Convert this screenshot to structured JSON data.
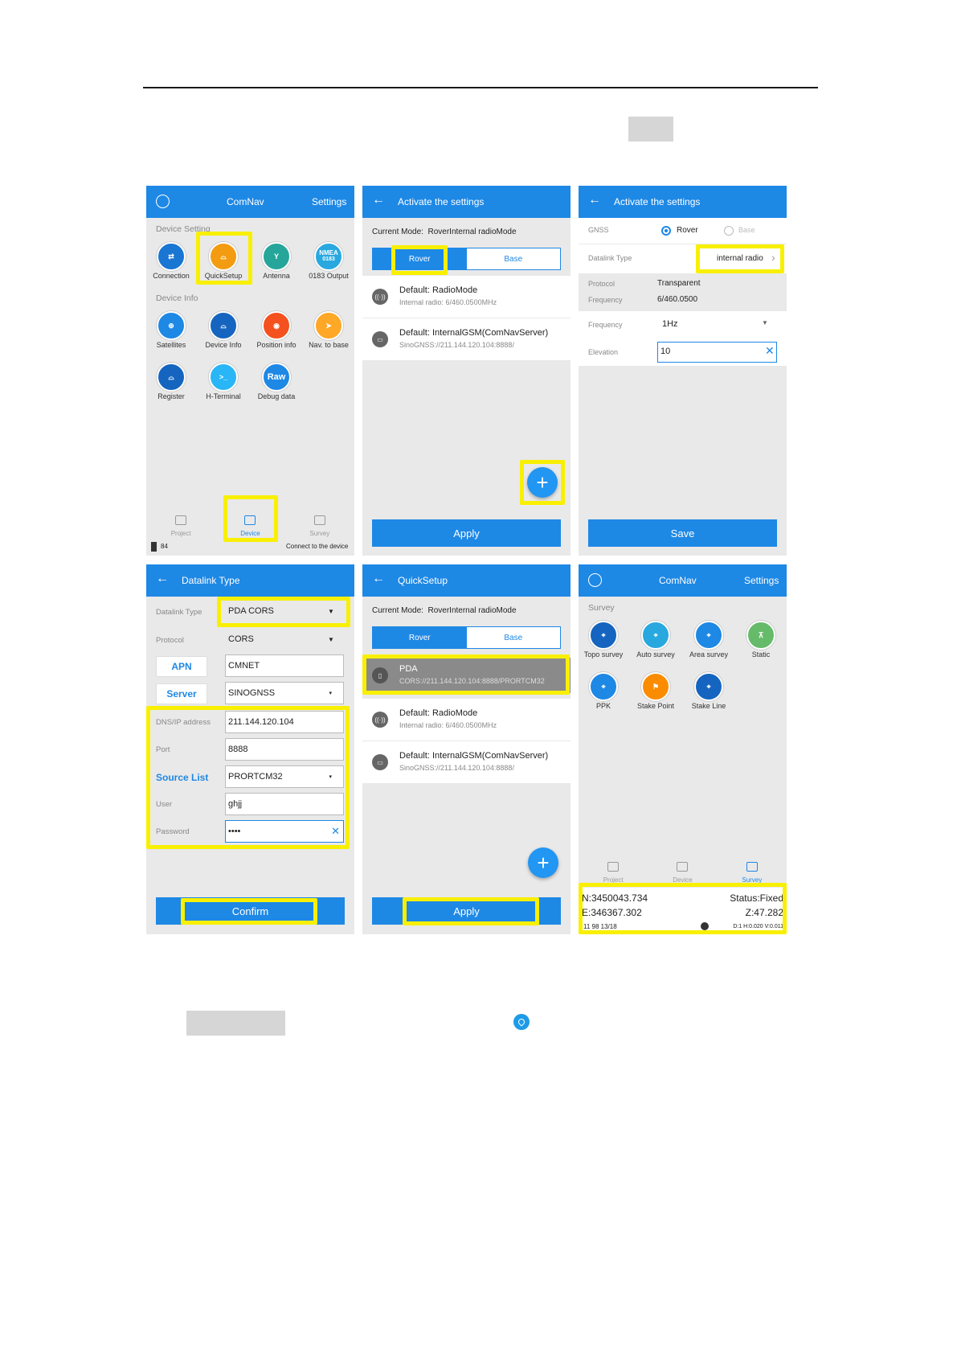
{
  "colors": {
    "accent": "#1e88e5",
    "highlight": "#f8f000",
    "panel_bg": "#e9e9e9"
  },
  "p1": {
    "title": "ComNav",
    "settings": "Settings",
    "group1": "Device Setting",
    "group2": "Device Info",
    "icons": [
      "Connection",
      "QuickSetup",
      "Antenna",
      "0183 Output",
      "Satellites",
      "Device Info",
      "Position info",
      "Nav. to base",
      "Register",
      "H-Terminal",
      "Debug data"
    ],
    "nmea_line1": "NMEA",
    "nmea_line2": "0183",
    "raw": "Raw",
    "nav": [
      "Project",
      "Device",
      "Survey"
    ],
    "battery": "84",
    "status": "Connect to the device"
  },
  "p2": {
    "title": "Activate the settings",
    "mode_label": "Current Mode:",
    "mode_value": "RoverInternal radioMode",
    "rover": "Rover",
    "base": "Base",
    "items": [
      {
        "t": "Default: RadioMode",
        "s": "Internal radio: 6/460.0500MHz"
      },
      {
        "t": "Default: InternalGSM(ComNavServer)",
        "s": "SinoGNSS://211.144.120.104:8888/"
      }
    ],
    "plus": "+",
    "apply": "Apply"
  },
  "p3": {
    "title": "Activate the settings",
    "gnss": "GNSS",
    "rover": "Rover",
    "base": "Base",
    "datalink": "Datalink Type",
    "datalink_val": "internal radio",
    "protocol": "Protocol",
    "protocol_val": "Transparent",
    "frequency": "Frequency",
    "frequency_val": "6/460.0500",
    "freq2": "Frequency",
    "freq2_val": "1Hz",
    "elevation": "Elevation",
    "elevation_val": "10",
    "save": "Save"
  },
  "p4": {
    "title": "Datalink Type",
    "datalink": "Datalink Type",
    "datalink_val": "PDA CORS",
    "protocol": "Protocol",
    "protocol_val": "CORS",
    "apn": "APN",
    "apn_val": "CMNET",
    "server": "Server",
    "server_val": "SINOGNSS",
    "dns": "DNS/IP address",
    "dns_val": "211.144.120.104",
    "port": "Port",
    "port_val": "8888",
    "source": "Source List",
    "source_val": "PRORTCM32",
    "user": "User",
    "user_val": "ghjj",
    "password": "Password",
    "password_val": "••••",
    "confirm": "Confirm"
  },
  "p5": {
    "title": "QuickSetup",
    "mode_label": "Current Mode:",
    "mode_value": "RoverInternal radioMode",
    "rover": "Rover",
    "base": "Base",
    "items": [
      {
        "t": "PDA",
        "s": "CORS://211.144.120.104:8888/PRORTCM32"
      },
      {
        "t": "Default: RadioMode",
        "s": "Internal radio: 6/460.0500MHz"
      },
      {
        "t": "Default: InternalGSM(ComNavServer)",
        "s": "SinoGNSS://211.144.120.104:8888/"
      }
    ],
    "plus": "+",
    "apply": "Apply"
  },
  "p6": {
    "title": "ComNav",
    "settings": "Settings",
    "group": "Survey",
    "icons": [
      "Topo survey",
      "Auto survey",
      "Area survey",
      "Static",
      "PPK",
      "Stake Point",
      "Stake Line"
    ],
    "nav": [
      "Project",
      "Device",
      "Survey"
    ],
    "n": "N:3450043.734",
    "e": "E:346367.302",
    "status": "Status:Fixed",
    "z": "Z:47.282",
    "bar": "11  98  13/18",
    "prec": "D:1 H:0.020 V:0.011"
  }
}
